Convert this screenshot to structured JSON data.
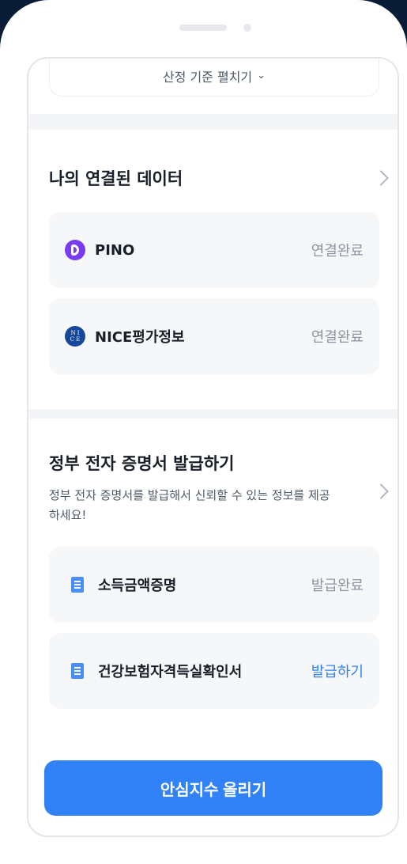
{
  "criteria_toggle": {
    "label": "산정 기준 펼치기"
  },
  "connected_data": {
    "title": "나의 연결된 데이터",
    "items": [
      {
        "name": "PINO",
        "status": "연결완료",
        "logo_text": ""
      },
      {
        "name": "NICE평가정보",
        "status": "연결완료",
        "logo_text_top": "N I",
        "logo_text_bottom": "C E"
      }
    ]
  },
  "certificates": {
    "title": "정부 전자 증명서 발급하기",
    "description": "정부 전자 증명서를 발급해서 신뢰할 수 있는 정보를 제공하세요!",
    "items": [
      {
        "name": "소득금액증명",
        "status": "발급완료"
      },
      {
        "name": "건강보험자격득실확인서",
        "status": "발급하기"
      }
    ]
  },
  "cta": {
    "label": "안심지수 올리기"
  },
  "colors": {
    "primary": "#3182f6",
    "pino": "#7a3cf0",
    "nice": "#17479a",
    "background": "#0a1f3c"
  }
}
